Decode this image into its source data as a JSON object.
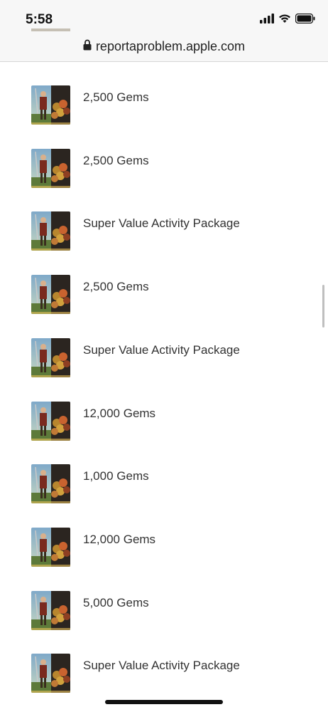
{
  "status": {
    "time": "5:58",
    "icons": [
      "signal-icon",
      "wifi-icon",
      "battery-icon"
    ]
  },
  "browser": {
    "url": "reportaproblem.apple.com",
    "lock_icon": "lock-icon"
  },
  "purchases": [
    {
      "title": "2,500 Gems"
    },
    {
      "title": "2,500 Gems"
    },
    {
      "title": "Super Value Activity Package"
    },
    {
      "title": "2,500 Gems"
    },
    {
      "title": "Super Value Activity Package"
    },
    {
      "title": "12,000 Gems"
    },
    {
      "title": "1,000 Gems"
    },
    {
      "title": "12,000 Gems"
    },
    {
      "title": "5,000 Gems"
    },
    {
      "title": "Super Value Activity Package"
    }
  ]
}
